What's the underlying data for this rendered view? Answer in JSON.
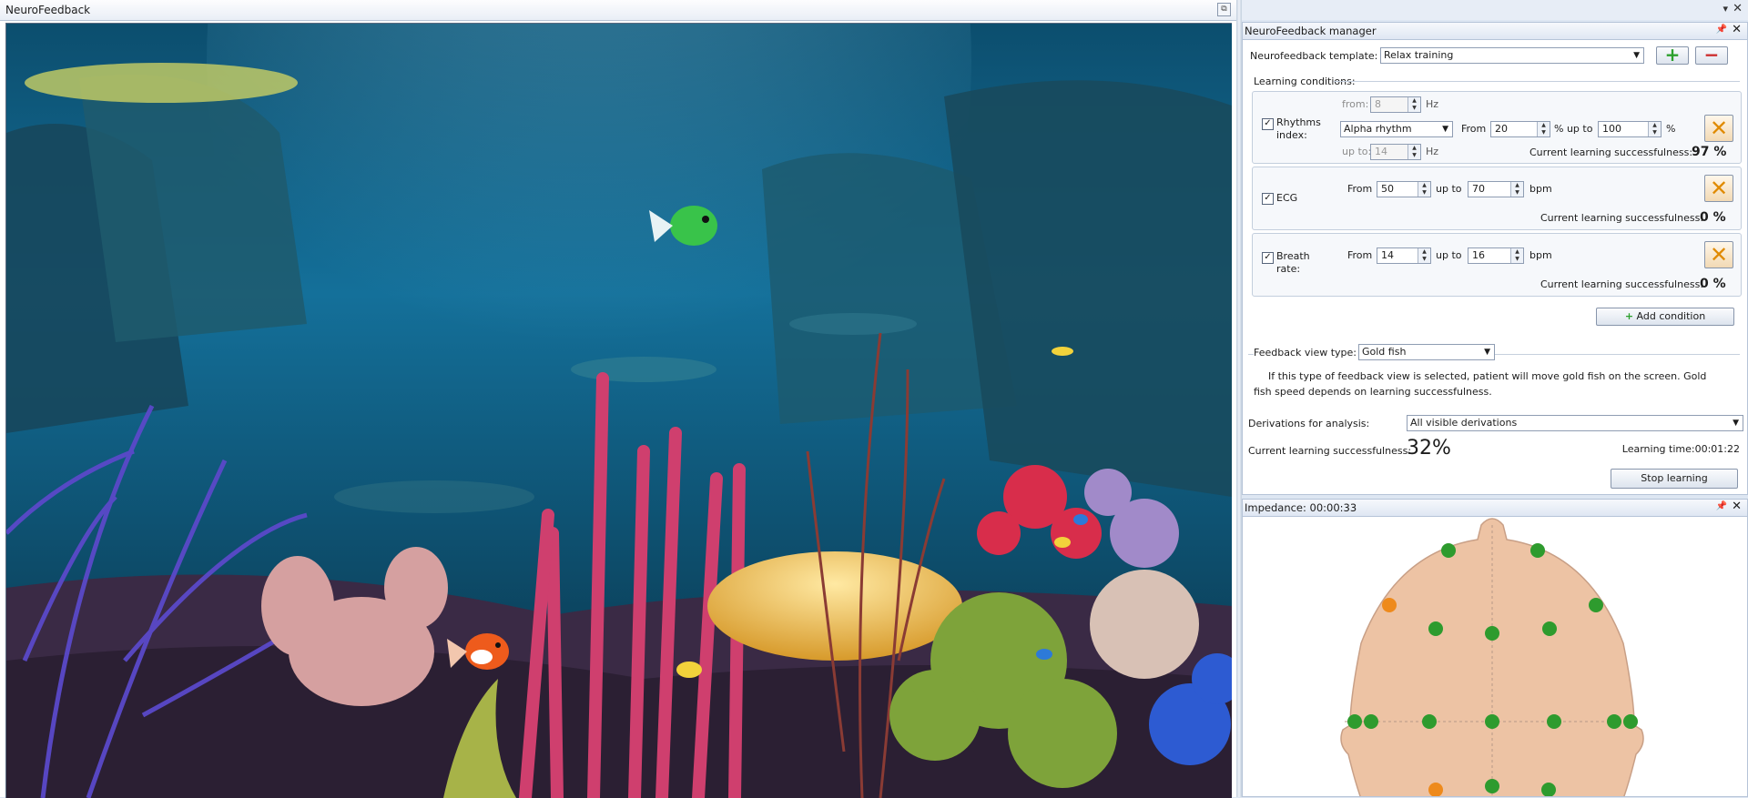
{
  "left_window": {
    "title": "NeuroFeedback"
  },
  "manager": {
    "title": "NeuroFeedback manager",
    "template_label": "Neurofeedback template:",
    "template_value": "Relax training",
    "learning_conditions_label": "Learning conditions:",
    "conditions": {
      "rhythm": {
        "name": "Rhythms index:",
        "from_hz_label": "from:",
        "from_hz_value": "8",
        "hz1": "Hz",
        "rhythm_value": "Alpha rhythm",
        "from_label": "From",
        "from_value": "20",
        "upto_label": "% up to",
        "upto_value": "100",
        "unit": "%",
        "upto_hz_label": "up to:",
        "upto_hz_value": "14",
        "hz2": "Hz",
        "success_label": "Current learning successfulness:",
        "success_value": "97 %"
      },
      "ecg": {
        "name": "ECG",
        "from_label": "From",
        "from_value": "50",
        "upto_label": "up to",
        "upto_value": "70",
        "unit": "bpm",
        "success_label": "Current learning successfulness:",
        "success_value": "0 %"
      },
      "breath": {
        "name": "Breath rate:",
        "from_label": "From",
        "from_value": "14",
        "upto_label": "up to",
        "upto_value": "16",
        "unit": "bpm",
        "success_label": "Current learning successfulness:",
        "success_value": "0 %"
      }
    },
    "add_condition_label": "Add condition",
    "feedback_view_label": "Feedback view type:",
    "feedback_view_value": "Gold fish",
    "feedback_desc": "If this type of feedback view is selected, patient will move gold fish on the screen. Gold fish speed depends on learning successfulness.",
    "derivations_label": "Derivations for analysis:",
    "derivations_value": "All visible derivations",
    "current_success_label": "Current learning successfulness:",
    "current_success_value": "32%",
    "learning_time": "Learning time:00:01:22",
    "stop_label": "Stop learning"
  },
  "impedance": {
    "title": "Impedance: 00:00:33"
  },
  "colors": {
    "electrode_good": "#2e9b2e",
    "electrode_warn": "#ee8a1c",
    "head_skin": "#edc3a4"
  }
}
